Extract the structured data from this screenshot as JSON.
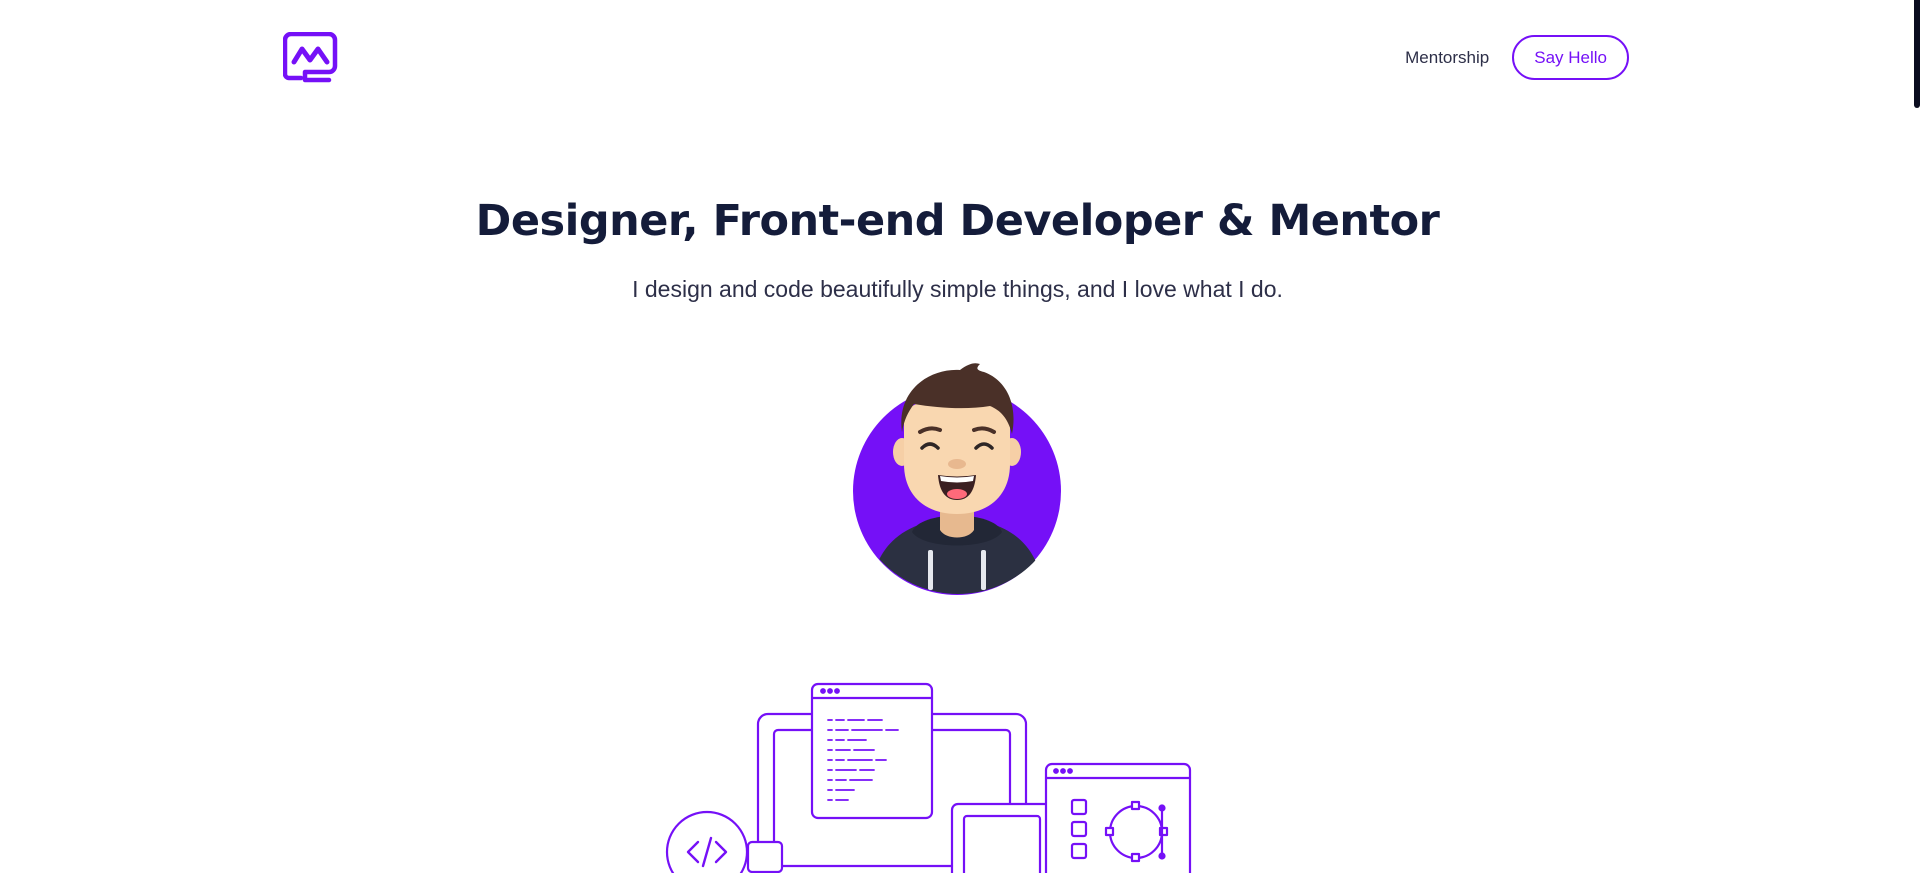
{
  "header": {
    "logo_icon": "brand-logo-icon",
    "nav": {
      "mentorship_label": "Mentorship",
      "say_hello_label": "Say Hello"
    }
  },
  "hero": {
    "title": "Designer, Front-end Developer & Mentor",
    "subtitle": "I design and code beautifully simple things, and I love what I do.",
    "avatar_icon": "avatar-illustration",
    "illustration_icon": "devices-illustration"
  },
  "colors": {
    "accent": "#7510f7",
    "heading": "#141c3a",
    "body_text": "#2d2f48",
    "background": "#ffffff"
  }
}
